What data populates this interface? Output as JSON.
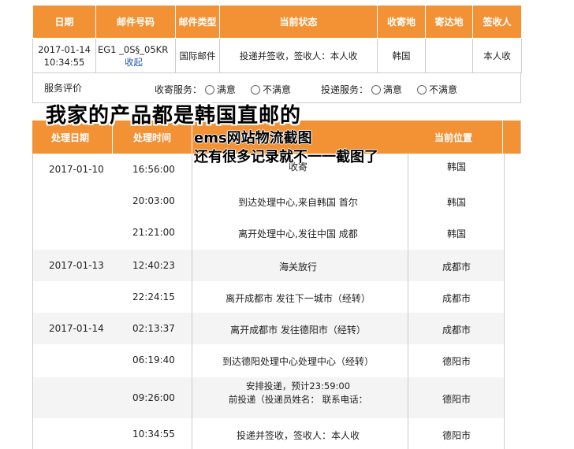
{
  "top_table": {
    "headers": [
      "日期",
      "邮件号码",
      "邮件类型",
      "当前状态",
      "收寄地",
      "寄达地",
      "签收人"
    ],
    "row": {
      "date": "2017-01-14 10:34:55",
      "mail_no": "EG1 _0S§_05KR",
      "collect_link": "收起",
      "mail_type": "国际邮件",
      "status": "投递并签收，签收人：本人收",
      "origin": "韩国",
      "destination": "",
      "signer": "本人收"
    }
  },
  "review": {
    "label": "服务评价",
    "collect_service": "收寄服务：",
    "deliver_service": "投递服务：",
    "satisfied": "满意",
    "unsatisfied": "不满意"
  },
  "captions": {
    "main": "我家的产品都是韩国直邮的",
    "sub1": "ems网站物流截图",
    "sub2": "还有很多记录就不一一截图了"
  },
  "track_table": {
    "headers": {
      "date": "处理日期",
      "time": "处理时间",
      "location": "当前位置"
    },
    "rows": [
      {
        "date": "2017-01-10",
        "time": "16:56:00",
        "desc": "收寄",
        "loc": "韩国"
      },
      {
        "date": "",
        "time": "20:03:00",
        "desc": "到达处理中心,来自韩国 首尔",
        "loc": "韩国"
      },
      {
        "date": "",
        "time": "21:21:00",
        "desc": "离开处理中心,发往中国 成都",
        "loc": "韩国"
      },
      {
        "date": "2017-01-13",
        "time": "12:40:23",
        "desc": "海关放行",
        "loc": "成都市"
      },
      {
        "date": "",
        "time": "22:24:15",
        "desc": "离开成都市 发往下一城市（经转）",
        "loc": "成都市"
      },
      {
        "date": "2017-01-14",
        "time": "02:13:37",
        "desc": "离开成都市 发往德阳市（经转）",
        "loc": "成都市"
      },
      {
        "date": "",
        "time": "06:19:40",
        "desc": "到达德阳处理中心处理中心（经转）",
        "loc": "德阳市"
      },
      {
        "date": "",
        "time": "09:26:00",
        "desc": "安排投递，预计23:59:00",
        "desc2": "前投递（投递员姓名： 联系电话：",
        "loc": "德阳市"
      },
      {
        "date": "",
        "time": "10:34:55",
        "desc": "投递并签收，签收人：本人收",
        "loc": "德阳市"
      }
    ]
  }
}
